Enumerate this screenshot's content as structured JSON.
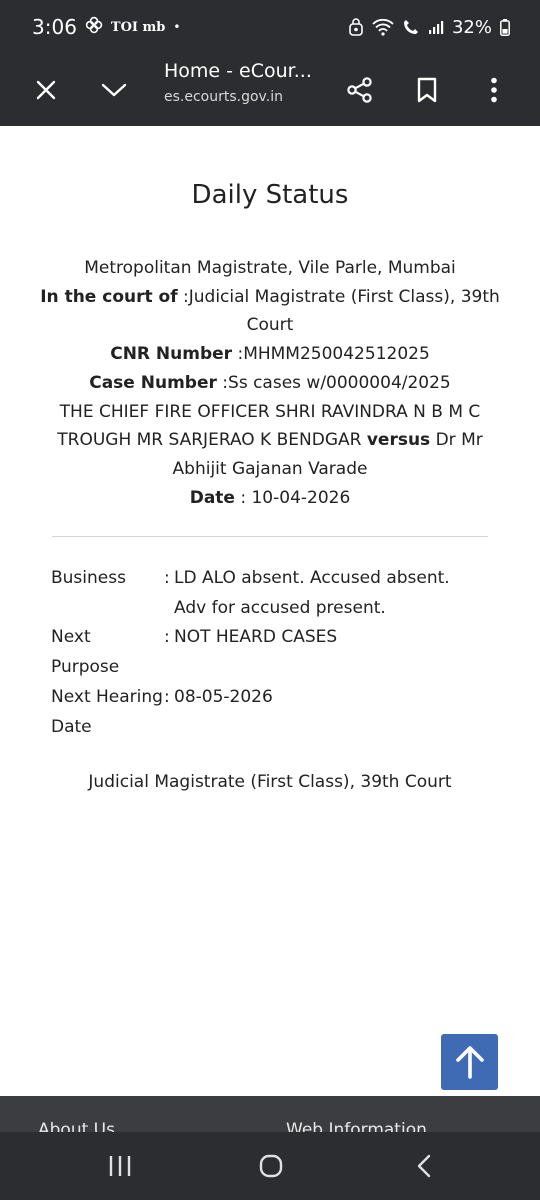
{
  "status_bar": {
    "time": "3:06",
    "app_label": "TOI mb",
    "dot": "•",
    "battery": "32%"
  },
  "browser": {
    "title": "Home - eCour...",
    "url": "es.ecourts.gov.in"
  },
  "page": {
    "title": "Daily Status",
    "court_location": "Metropolitan Magistrate, Vile Parle, Mumbai",
    "court_label": "In the court of",
    "court_value": " :Judicial Magistrate (First Class), 39th Court",
    "cnr_label": "CNR Number",
    "cnr_value": " :MHMM250042512025",
    "case_label": "Case Number",
    "case_value": " :Ss cases w/0000004/2025",
    "party_1": "THE CHIEF FIRE OFFICER SHRI RAVINDRA N B M C TROUGH MR SARJERAO K BENDGAR ",
    "versus": "versus",
    "party_2": "  Dr Mr Abhijit Gajanan Varade",
    "date_label": "Date",
    "date_value": "  : 10-04-2026"
  },
  "details": [
    {
      "label": "Business",
      "colon": ":",
      "value": "LD ALO absent. Accused absent. Adv for accused present."
    },
    {
      "label": "Next Purpose",
      "colon": ":",
      "value": "NOT HEARD CASES"
    },
    {
      "label": "Next Hearing Date",
      "colon": ":",
      "value": "08-05-2026"
    }
  ],
  "court_footer": "Judicial Magistrate (First Class), 39th Court",
  "site_footer": {
    "about": "About Us",
    "web_info": "Web Information"
  },
  "colors": {
    "chrome": "#2b2d30",
    "scroll_button": "#3f6bb5"
  },
  "icons": {
    "close": "close-icon",
    "expand": "chevron-down-icon",
    "share": "share-icon",
    "bookmark": "bookmark-icon",
    "menu": "more-vert-icon",
    "scroll_top": "arrow-up-icon"
  }
}
